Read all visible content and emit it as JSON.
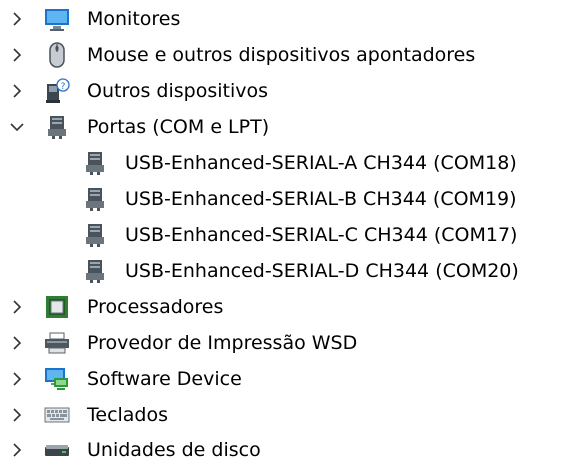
{
  "tree": {
    "items": [
      {
        "label": "Monitores",
        "icon": "monitor-icon",
        "expanded": false
      },
      {
        "label": "Mouse e outros dispositivos apontadores",
        "icon": "mouse-icon",
        "expanded": false
      },
      {
        "label": "Outros dispositivos",
        "icon": "unknown-device-icon",
        "expanded": false
      },
      {
        "label": "Portas (COM e LPT)",
        "icon": "port-icon",
        "expanded": true,
        "children": [
          {
            "label": "USB-Enhanced-SERIAL-A CH344 (COM18)",
            "icon": "port-icon"
          },
          {
            "label": "USB-Enhanced-SERIAL-B CH344 (COM19)",
            "icon": "port-icon"
          },
          {
            "label": "USB-Enhanced-SERIAL-C CH344 (COM17)",
            "icon": "port-icon"
          },
          {
            "label": "USB-Enhanced-SERIAL-D CH344 (COM20)",
            "icon": "port-icon"
          }
        ]
      },
      {
        "label": "Processadores",
        "icon": "processor-icon",
        "expanded": false
      },
      {
        "label": "Provedor de Impressão WSD",
        "icon": "printer-icon",
        "expanded": false
      },
      {
        "label": "Software Device",
        "icon": "software-device-icon",
        "expanded": false
      },
      {
        "label": "Teclados",
        "icon": "keyboard-icon",
        "expanded": false
      },
      {
        "label": "Unidades de disco",
        "icon": "disk-drive-icon",
        "expanded": false
      }
    ]
  }
}
